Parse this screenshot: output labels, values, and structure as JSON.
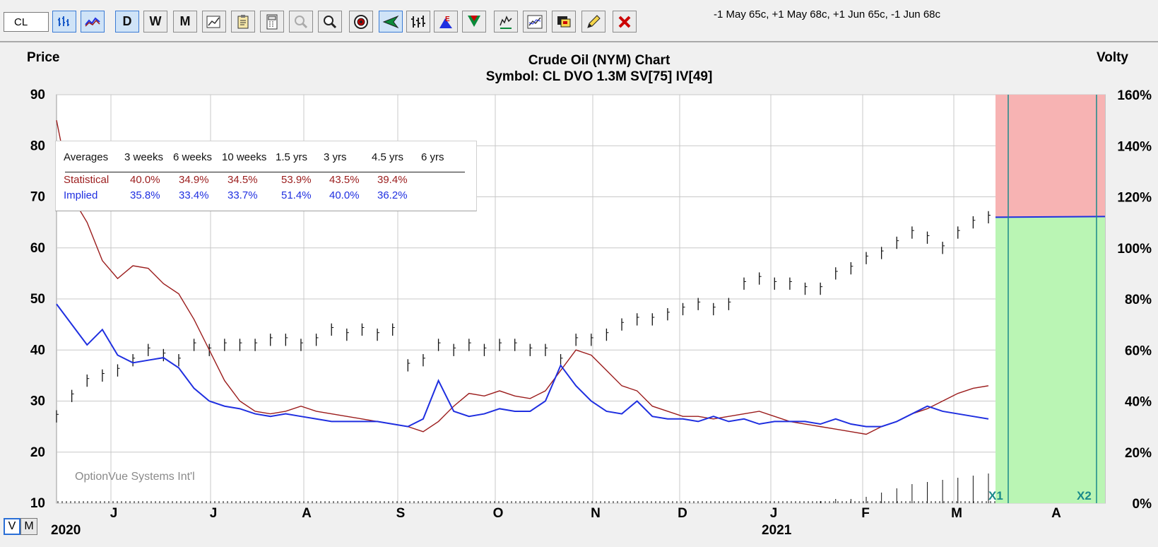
{
  "toolbar": {
    "symbol_value": "CL",
    "buttons": [
      {
        "name": "bar-chart-button",
        "icon": "price-bars-icon",
        "label": "",
        "active": true
      },
      {
        "name": "line-chart-button",
        "icon": "volatility-lines-icon",
        "label": "",
        "active": true
      },
      {
        "name": "daily-button",
        "icon": "",
        "label": "D",
        "active": true
      },
      {
        "name": "weekly-button",
        "icon": "",
        "label": "W",
        "active": false
      },
      {
        "name": "monthly-button",
        "icon": "",
        "label": "M",
        "active": false
      },
      {
        "name": "chart-settings-button",
        "icon": "chart-settings-icon",
        "label": "",
        "active": false
      },
      {
        "name": "clipboard-button",
        "icon": "clipboard-icon",
        "label": "",
        "active": false
      },
      {
        "name": "calculator-button",
        "icon": "calculator-icon",
        "label": "",
        "active": false
      },
      {
        "name": "zoom-in-button",
        "icon": "zoom-in-icon",
        "label": "",
        "active": false
      },
      {
        "name": "zoom-out-button",
        "icon": "zoom-out-icon",
        "label": "",
        "active": false
      },
      {
        "name": "target-button",
        "icon": "target-icon",
        "label": "",
        "active": false
      },
      {
        "name": "cursor-button",
        "icon": "cursor-arrow-icon",
        "label": "",
        "active": true
      },
      {
        "name": "bars-style-button",
        "icon": "ohlc-bars-icon",
        "label": "",
        "active": false
      },
      {
        "name": "earnings-button",
        "icon": "earnings-icon",
        "label": "",
        "active": false
      },
      {
        "name": "dividend-button",
        "icon": "dividend-icon",
        "label": "",
        "active": false
      },
      {
        "name": "study-button",
        "icon": "study-icon",
        "label": "",
        "active": false
      },
      {
        "name": "indicator-button",
        "icon": "indicator-icon",
        "label": "",
        "active": false
      },
      {
        "name": "chat-button",
        "icon": "chat-icon",
        "label": "",
        "active": false
      },
      {
        "name": "draw-button",
        "icon": "pencil-icon",
        "label": "",
        "active": false
      },
      {
        "name": "close-button",
        "icon": "close-icon",
        "label": "",
        "active": false
      }
    ],
    "strategy_text": "-1 May 65c, +1 May 68c, +1 Jun 65c, -1 Jun 68c"
  },
  "colors": {
    "statistical": "#9b1c1c",
    "implied": "#1f2fe0",
    "price": "#111111",
    "profit_zone": "#baf5b4",
    "loss_zone": "#f7b3b3",
    "exp_line": "#1a8a8a"
  },
  "averages": {
    "headers": [
      "Averages",
      "3 weeks",
      "6 weeks",
      "10 weeks",
      "1.5 yrs",
      "3 yrs",
      "4.5 yrs",
      "6 yrs"
    ],
    "statistical": {
      "label": "Statistical",
      "values": [
        "40.0%",
        "34.9%",
        "34.5%",
        "53.9%",
        "43.5%",
        "39.4%",
        ""
      ]
    },
    "implied": {
      "label": "Implied",
      "values": [
        "35.8%",
        "33.4%",
        "33.7%",
        "51.4%",
        "40.0%",
        "36.2%",
        ""
      ]
    }
  },
  "chart_data": {
    "type": "line",
    "title": "Crude Oil (NYM) Chart",
    "subtitle": "Symbol: CL  DVO 1.3M  SV[75]  IV[49]",
    "ylabel_left": "Price",
    "ylabel_right": "Volty",
    "ylim_left": [
      10,
      90
    ],
    "yticks_left": [
      "90",
      "80",
      "70",
      "60",
      "50",
      "40",
      "30",
      "20",
      "10"
    ],
    "ylim_right": [
      0,
      160
    ],
    "yticks_right": [
      "160%",
      "140%",
      "120%",
      "100%",
      "80%",
      "60%",
      "40%",
      "20%",
      "0%"
    ],
    "month_labels": [
      "J",
      "J",
      "A",
      "S",
      "O",
      "N",
      "D",
      "J",
      "F",
      "M",
      "A"
    ],
    "year_labels": [
      "2020",
      "2021"
    ],
    "watermark": "OptionVue Systems Int'l",
    "expiration_markers": [
      "X1",
      "X2"
    ],
    "grid": true,
    "series": [
      {
        "name": "Price",
        "style": "ohlc-bars",
        "x": [
          0,
          5,
          10,
          15,
          20,
          25,
          30,
          35,
          40,
          45,
          50,
          55,
          60,
          65,
          70,
          75,
          80,
          85,
          90,
          95,
          100,
          105,
          110,
          115,
          120,
          125,
          130,
          135,
          140,
          145,
          150,
          155,
          160,
          165,
          170,
          175,
          180,
          185,
          190,
          195,
          200,
          205,
          210,
          215,
          220,
          225,
          230,
          235,
          240,
          245,
          250,
          255,
          260,
          265,
          270,
          275,
          280,
          285,
          290,
          295,
          300,
          305
        ],
        "values": [
          27,
          31,
          34,
          35,
          36,
          38,
          40,
          39,
          38,
          41,
          40,
          41,
          41,
          41,
          42,
          42,
          41,
          42,
          44,
          43,
          44,
          43,
          44,
          37,
          38,
          41,
          40,
          41,
          40,
          41,
          41,
          40,
          40,
          38,
          42,
          42,
          43,
          45,
          46,
          46,
          47,
          48,
          49,
          48,
          49,
          53,
          54,
          53,
          53,
          52,
          52,
          55,
          56,
          58,
          59,
          61,
          63,
          62,
          60,
          63,
          65,
          66
        ]
      },
      {
        "name": "Statistical",
        "style": "line",
        "x": [
          0,
          5,
          10,
          15,
          20,
          25,
          30,
          35,
          40,
          45,
          50,
          55,
          60,
          65,
          70,
          75,
          80,
          85,
          90,
          95,
          100,
          105,
          110,
          115,
          120,
          125,
          130,
          135,
          140,
          145,
          150,
          155,
          160,
          165,
          170,
          175,
          180,
          185,
          190,
          195,
          200,
          205,
          210,
          215,
          220,
          225,
          230,
          235,
          240,
          245,
          250,
          255,
          260,
          265,
          270,
          275,
          280,
          285,
          290,
          295,
          300,
          305
        ],
        "values": [
          150,
          120,
          110,
          95,
          88,
          93,
          92,
          86,
          82,
          72,
          60,
          48,
          40,
          36,
          35,
          36,
          38,
          36,
          35,
          34,
          33,
          32,
          31,
          30,
          28,
          32,
          38,
          43,
          42,
          44,
          42,
          41,
          44,
          52,
          60,
          58,
          52,
          46,
          44,
          38,
          36,
          34,
          34,
          33,
          34,
          35,
          36,
          34,
          32,
          31,
          30,
          29,
          28,
          27,
          30,
          32,
          35,
          37,
          40,
          43,
          45,
          46
        ]
      },
      {
        "name": "Implied",
        "style": "line",
        "x": [
          0,
          5,
          10,
          15,
          20,
          25,
          30,
          35,
          40,
          45,
          50,
          55,
          60,
          65,
          70,
          75,
          80,
          85,
          90,
          95,
          100,
          105,
          110,
          115,
          120,
          125,
          130,
          135,
          140,
          145,
          150,
          155,
          160,
          165,
          170,
          175,
          180,
          185,
          190,
          195,
          200,
          205,
          210,
          215,
          220,
          225,
          230,
          235,
          240,
          245,
          250,
          255,
          260,
          265,
          270,
          275,
          280,
          285,
          290,
          295,
          300,
          305
        ],
        "values": [
          78,
          70,
          62,
          68,
          58,
          55,
          56,
          57,
          53,
          45,
          40,
          38,
          37,
          35,
          34,
          35,
          34,
          33,
          32,
          32,
          32,
          32,
          31,
          30,
          33,
          48,
          36,
          34,
          35,
          37,
          36,
          36,
          40,
          54,
          46,
          40,
          36,
          35,
          40,
          34,
          33,
          33,
          32,
          34,
          32,
          33,
          31,
          32,
          32,
          32,
          31,
          33,
          31,
          30,
          30,
          32,
          35,
          38,
          36,
          35,
          34,
          33
        ]
      },
      {
        "name": "Volume",
        "style": "bars",
        "x": [
          250,
          255,
          260,
          265,
          270,
          275,
          280,
          285,
          290,
          295,
          300,
          305
        ],
        "values": [
          1,
          2,
          2,
          3,
          5,
          7,
          9,
          10,
          11,
          12,
          13,
          14
        ]
      }
    ],
    "risk_graph": {
      "start_x": 1409,
      "x1": 1427,
      "x2": 1552,
      "breakeven_price": 66
    }
  }
}
